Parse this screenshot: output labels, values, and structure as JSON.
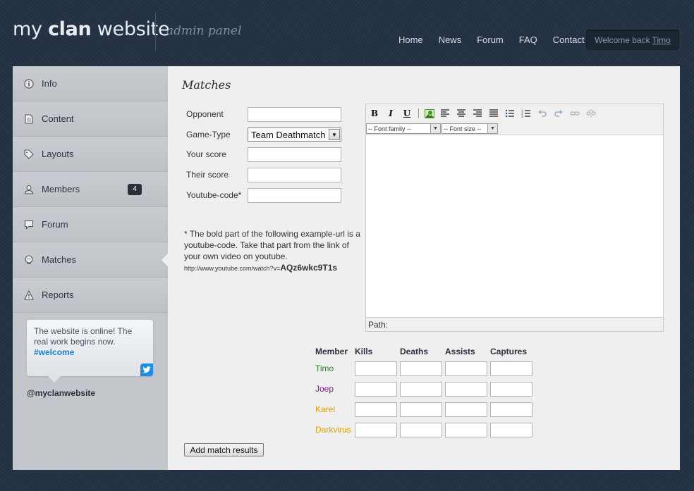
{
  "header": {
    "logo_pre": "my ",
    "logo_bold": "clan",
    "logo_post": " website",
    "admin_label": "admin panel",
    "nav": [
      "Home",
      "News",
      "Forum",
      "FAQ",
      "Contact"
    ],
    "welcome_text": "Welcome back",
    "welcome_user": "Timo"
  },
  "sidebar": {
    "items": [
      {
        "label": "Info",
        "icon": "info-icon"
      },
      {
        "label": "Content",
        "icon": "document-icon"
      },
      {
        "label": "Layouts",
        "icon": "tag-icon"
      },
      {
        "label": "Members",
        "icon": "user-icon",
        "badge": "4"
      },
      {
        "label": "Forum",
        "icon": "forum-icon"
      },
      {
        "label": "Matches",
        "icon": "matches-icon",
        "active": true
      },
      {
        "label": "Reports",
        "icon": "warning-icon"
      }
    ],
    "tweet_text": "The website is online! The real work begins now.",
    "tweet_hashtag": "#welcome",
    "twitter_handle": "@myclanwebsite"
  },
  "main": {
    "title": "Matches",
    "form": {
      "opponent_label": "Opponent",
      "gametype_label": "Game-Type",
      "gametype_value": "Team Deathmatch",
      "your_score_label": "Your score",
      "their_score_label": "Their score",
      "youtube_label": "Youtube-code*"
    },
    "note": {
      "text": "* The bold part of the following example-url is a youtube-code. Take that part from the link of your own video on youtube.",
      "url_prefix": "http://www.youtube.com/watch?v=",
      "url_code": "AQz6wkc9T1s"
    },
    "editor": {
      "font_family": "-- Font family --",
      "font_size": "-- Font size --",
      "path_label": "Path:"
    },
    "results": {
      "headers": [
        "Member",
        "Kills",
        "Deaths",
        "Assists",
        "Captures"
      ],
      "members": [
        {
          "name": "Timo",
          "color": "#1d8a1d"
        },
        {
          "name": "Joep",
          "color": "#7a1a8a"
        },
        {
          "name": "Karel",
          "color": "#e0a000"
        },
        {
          "name": "Darkvirus",
          "color": "#e0a000"
        }
      ]
    },
    "add_button": "Add match results"
  },
  "colors": {
    "background": "#243244",
    "sidebar": "#c3c7cc",
    "panel": "#efefef",
    "twitter": "#1f8ee0"
  }
}
